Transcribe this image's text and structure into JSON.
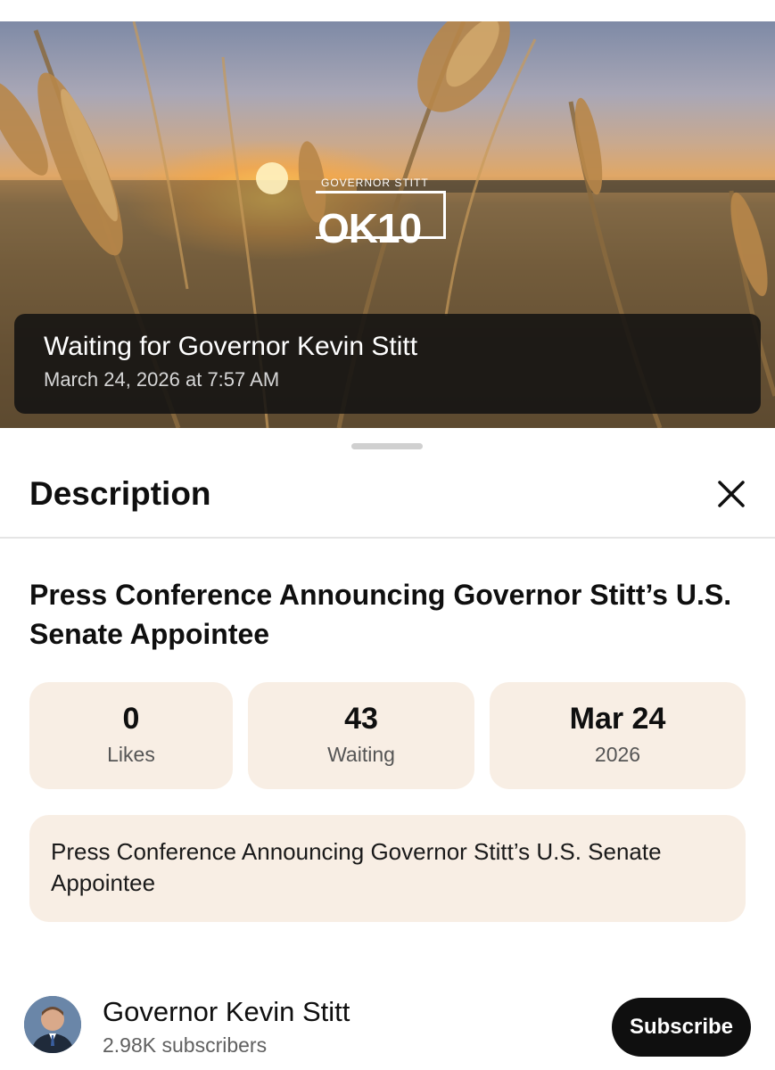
{
  "live": {
    "logo_top": "GOVERNOR STITT",
    "logo_main": "OK10",
    "title": "Waiting for Governor Kevin Stitt",
    "scheduled": "March 24, 2026 at 7:57 AM"
  },
  "sheet": {
    "title": "Description",
    "close_icon": "close-icon"
  },
  "video": {
    "title": "Press Conference Announcing Governor Stitt’s U.S. Senate Appointee"
  },
  "stats": [
    {
      "value": "0",
      "label": "Likes"
    },
    {
      "value": "43",
      "label": "Waiting"
    },
    {
      "value": "Mar 24",
      "label": "2026"
    }
  ],
  "description": {
    "text": "Press Conference Announcing Governor Stitt’s U.S. Senate Appointee"
  },
  "channel": {
    "name": "Governor Kevin Stitt",
    "subscribers": "2.98K subscribers",
    "subscribe_label": "Subscribe"
  },
  "colors": {
    "stat_bg": "#f8eee4",
    "subscribe_bg": "#0f0f0f",
    "overlay_bg": "#121212"
  }
}
